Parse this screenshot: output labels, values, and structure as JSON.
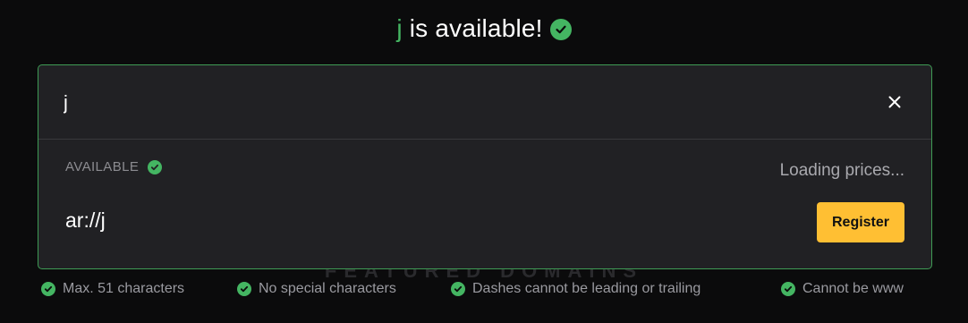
{
  "headline": {
    "name": "j",
    "suffix": "is available!",
    "status_icon": "check-circle-icon"
  },
  "background": {
    "faint_text": "FEATURED DOMAINS"
  },
  "search": {
    "value": "j",
    "placeholder": "",
    "clear_icon": "close-icon"
  },
  "result": {
    "status_label": "AVAILABLE",
    "status_icon": "check-circle-icon",
    "price_text": "Loading prices...",
    "domain": "ar://j",
    "register_label": "Register"
  },
  "rules": [
    {
      "label": "Max. 51 characters",
      "icon": "check-circle-icon"
    },
    {
      "label": "No special characters",
      "icon": "check-circle-icon"
    },
    {
      "label": "Dashes cannot be leading or trailing",
      "icon": "check-circle-icon"
    },
    {
      "label": "Cannot be www",
      "icon": "check-circle-icon"
    }
  ],
  "colors": {
    "background": "#0b0b0c",
    "panel": "#212124",
    "accent_green": "#44b562",
    "panel_border": "#3f9b55",
    "register_button": "#ffbf33"
  }
}
